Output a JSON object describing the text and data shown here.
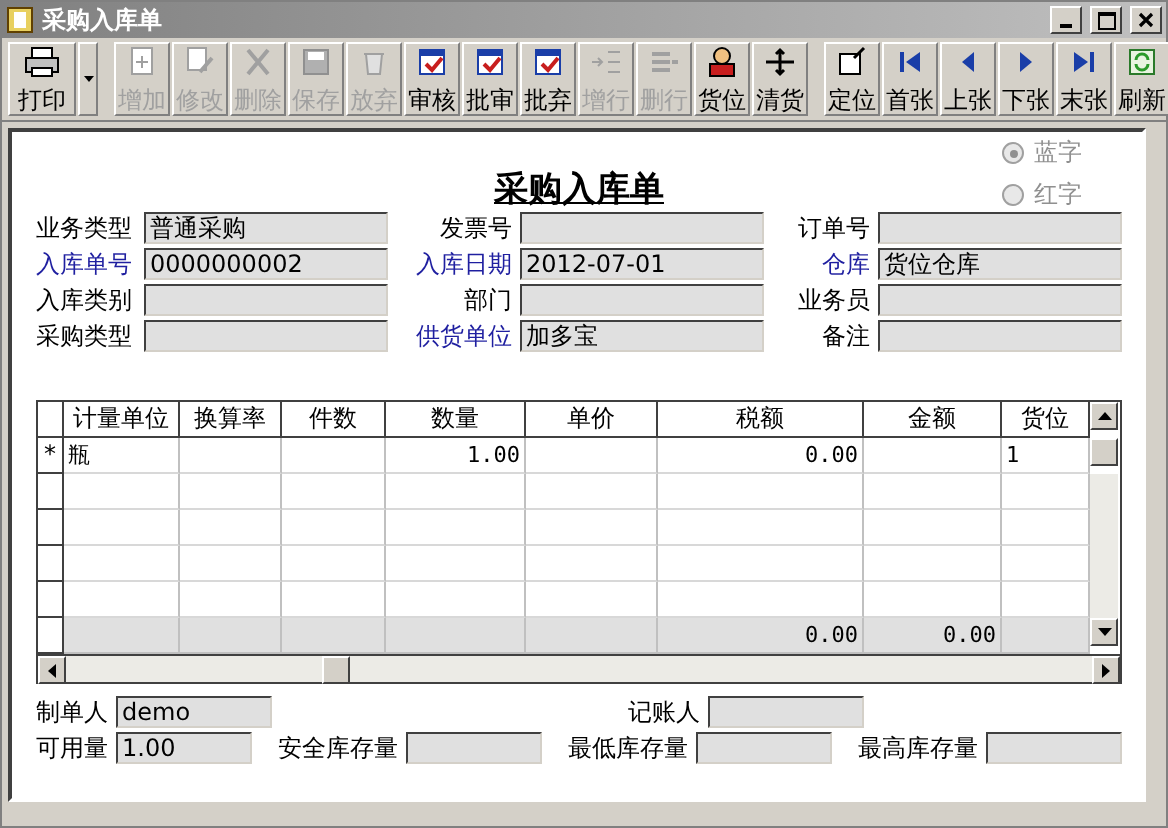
{
  "window": {
    "title": "采购入库单"
  },
  "toolbar": {
    "groups": [
      [
        {
          "label": "打印",
          "disabled": false,
          "dropdown": true
        }
      ],
      [
        {
          "label": "增加",
          "disabled": true
        },
        {
          "label": "修改",
          "disabled": true
        },
        {
          "label": "删除",
          "disabled": true
        },
        {
          "label": "保存",
          "disabled": true
        },
        {
          "label": "放弃",
          "disabled": true
        },
        {
          "label": "审核",
          "disabled": false
        },
        {
          "label": "批审",
          "disabled": false
        },
        {
          "label": "批弃",
          "disabled": false
        },
        {
          "label": "增行",
          "disabled": true
        },
        {
          "label": "删行",
          "disabled": true
        },
        {
          "label": "货位",
          "disabled": false
        },
        {
          "label": "清货",
          "disabled": false
        }
      ],
      [
        {
          "label": "定位",
          "disabled": false
        },
        {
          "label": "首张",
          "disabled": false
        },
        {
          "label": "上张",
          "disabled": false
        },
        {
          "label": "下张",
          "disabled": false
        },
        {
          "label": "末张",
          "disabled": false
        },
        {
          "label": "刷新",
          "disabled": false
        }
      ]
    ]
  },
  "form": {
    "title": "采购入库单",
    "color_options": [
      {
        "label": "蓝字",
        "selected": true
      },
      {
        "label": "红字",
        "selected": false
      }
    ],
    "fields": [
      [
        {
          "label": "业务类型",
          "value": "普通采购",
          "required": false
        },
        {
          "label": "发票号",
          "required": false
        },
        {
          "label": "订单号",
          "required": false
        }
      ],
      [
        {
          "label": "入库单号",
          "value": "0000000002",
          "required": true
        },
        {
          "label": "入库日期",
          "value": "2012-07-01",
          "required": true
        },
        {
          "label": "仓库",
          "value": "货位仓库",
          "required": true
        }
      ],
      [
        {
          "label": "入库类别",
          "required": false
        },
        {
          "label": "部门",
          "required": false
        },
        {
          "label": "业务员",
          "required": false
        }
      ],
      [
        {
          "label": "采购类型",
          "required": false
        },
        {
          "label": "供货单位",
          "value": "加多宝",
          "required": true
        },
        {
          "label": "备注",
          "required": false
        }
      ]
    ]
  },
  "table": {
    "columns": [
      "计量单位",
      "换算率",
      "件数",
      "数量",
      "单价",
      "税额",
      "金额",
      "货位"
    ],
    "rows": [
      {
        "kind": "data",
        "marker": "*",
        "cells": [
          "瓶",
          null,
          null,
          "1.00",
          null,
          "0.00",
          null,
          "1"
        ]
      },
      {
        "kind": "data",
        "cells": [
          null,
          null,
          null,
          null,
          null,
          null,
          null,
          null
        ]
      },
      {
        "kind": "data",
        "cells": [
          null,
          null,
          null,
          null,
          null,
          null,
          null,
          null
        ]
      },
      {
        "kind": "data",
        "cells": [
          null,
          null,
          null,
          null,
          null,
          null,
          null,
          null
        ]
      },
      {
        "kind": "data",
        "cells": [
          null,
          null,
          null,
          null,
          null,
          null,
          null,
          null
        ]
      },
      {
        "kind": "total",
        "cells": [
          null,
          null,
          null,
          null,
          null,
          "0.00",
          "0.00",
          null
        ]
      }
    ]
  },
  "footer": [
    [
      {
        "label": "制单人",
        "value": "demo"
      },
      {
        "label": "记账人"
      }
    ],
    [
      {
        "label": "可用量",
        "value": "1.00"
      },
      {
        "label": "安全库存量"
      },
      {
        "label": "最低库存量"
      },
      {
        "label": "最高库存量"
      }
    ]
  ]
}
